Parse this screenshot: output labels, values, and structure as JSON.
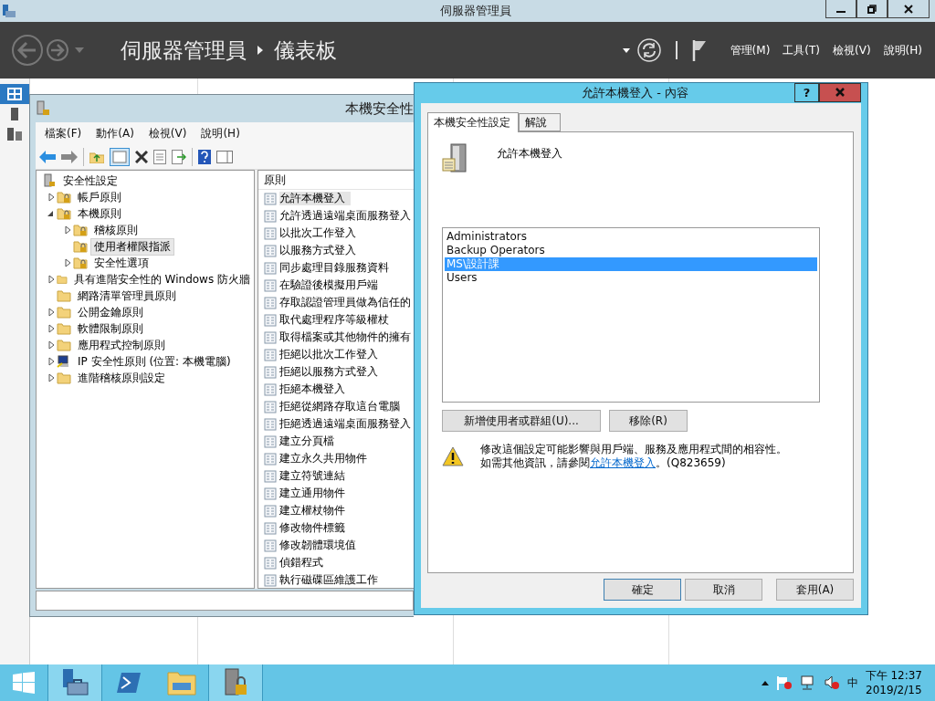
{
  "server_manager": {
    "title": "伺服器管理員",
    "breadcrumb": [
      "伺服器管理員",
      "儀表板"
    ],
    "menus": [
      "管理(M)",
      "工具(T)",
      "檢視(V)",
      "說明(H)"
    ],
    "nav": [
      {
        "kind": "dashboard",
        "selected": true
      },
      {
        "kind": "server",
        "selected": false
      },
      {
        "kind": "servers",
        "selected": false
      }
    ]
  },
  "policy_window": {
    "title": "本機安全性",
    "menus": [
      "檔案(F)",
      "動作(A)",
      "檢視(V)",
      "說明(H)"
    ],
    "tree": [
      {
        "label": "安全性設定",
        "kind": "root",
        "selected": false,
        "children": [
          {
            "label": "帳戶原則",
            "kind": "locked",
            "expanded": false,
            "selected": false
          },
          {
            "label": "本機原則",
            "kind": "locked",
            "expanded": true,
            "selected": false,
            "children": [
              {
                "label": "稽核原則",
                "kind": "locked",
                "expanded": false,
                "selected": false
              },
              {
                "label": "使用者權限指派",
                "kind": "locked",
                "selected": true
              },
              {
                "label": "安全性選項",
                "kind": "locked",
                "expanded": false,
                "selected": false
              }
            ]
          },
          {
            "label": "具有進階安全性的 Windows 防火牆",
            "kind": "folder",
            "expanded": false,
            "selected": false
          },
          {
            "label": "網路清單管理員原則",
            "kind": "folder",
            "selected": false
          },
          {
            "label": "公開金鑰原則",
            "kind": "folder",
            "expanded": false,
            "selected": false
          },
          {
            "label": "軟體限制原則",
            "kind": "folder",
            "expanded": false,
            "selected": false
          },
          {
            "label": "應用程式控制原則",
            "kind": "folder",
            "expanded": false,
            "selected": false
          },
          {
            "label": "IP 安全性原則 (位置: 本機電腦)",
            "kind": "ip",
            "expanded": false,
            "selected": false
          },
          {
            "label": "進階稽核原則設定",
            "kind": "folder",
            "expanded": false,
            "selected": false
          }
        ]
      }
    ],
    "list_header": "原則",
    "policies": [
      {
        "label": "允許本機登入",
        "selected": true
      },
      {
        "label": "允許透過遠端桌面服務登入",
        "selected": false
      },
      {
        "label": "以批次工作登入",
        "selected": false
      },
      {
        "label": "以服務方式登入",
        "selected": false
      },
      {
        "label": "同步處理目錄服務資料",
        "selected": false
      },
      {
        "label": "在驗證後模擬用戶端",
        "selected": false
      },
      {
        "label": "存取認證管理員做為信任的",
        "selected": false
      },
      {
        "label": "取代處理程序等級權杖",
        "selected": false
      },
      {
        "label": "取得檔案或其他物件的擁有",
        "selected": false
      },
      {
        "label": "拒絕以批次工作登入",
        "selected": false
      },
      {
        "label": "拒絕以服務方式登入",
        "selected": false
      },
      {
        "label": "拒絕本機登入",
        "selected": false
      },
      {
        "label": "拒絕從網路存取這台電腦",
        "selected": false
      },
      {
        "label": "拒絕透過遠端桌面服務登入",
        "selected": false
      },
      {
        "label": "建立分頁檔",
        "selected": false
      },
      {
        "label": "建立永久共用物件",
        "selected": false
      },
      {
        "label": "建立符號連結",
        "selected": false
      },
      {
        "label": "建立通用物件",
        "selected": false
      },
      {
        "label": "建立權杖物件",
        "selected": false
      },
      {
        "label": "修改物件標籤",
        "selected": false
      },
      {
        "label": "修改韌體環境值",
        "selected": false
      },
      {
        "label": "偵錯程式",
        "selected": false
      },
      {
        "label": "執行磁碟區維護工作",
        "selected": false
      }
    ]
  },
  "dialog": {
    "title": "允許本機登入 - 內容",
    "help": "?",
    "tabs": [
      {
        "label": "本機安全性設定",
        "selected": true
      },
      {
        "label": "解說",
        "selected": false
      }
    ],
    "policy_name": "允許本機登入",
    "members": [
      {
        "name": "Administrators",
        "selected": false
      },
      {
        "name": "Backup Operators",
        "selected": false
      },
      {
        "name": "MS\\設計課",
        "selected": true
      },
      {
        "name": "Users",
        "selected": false
      }
    ],
    "add_button": "新增使用者或群組(U)...",
    "remove_button": "移除(R)",
    "warning": "修改這個設定可能影響與用戶端、服務及應用程式間的相容性。",
    "info_prefix": "如需其他資訊，請參閱",
    "info_link": "允許本機登入",
    "info_suffix": "。(Q823659)",
    "buttons": [
      {
        "label": "確定",
        "default": true
      },
      {
        "label": "取消",
        "default": false
      },
      {
        "label": "套用(A)",
        "default": false
      }
    ]
  },
  "taskbar": {
    "apps": [
      {
        "kind": "server-manager",
        "active": true
      },
      {
        "kind": "powershell",
        "active": false
      },
      {
        "kind": "explorer",
        "active": false
      },
      {
        "kind": "security-policy",
        "active": true
      }
    ],
    "ime": "中",
    "time": "下午 12:37",
    "date": "2019/2/15"
  }
}
